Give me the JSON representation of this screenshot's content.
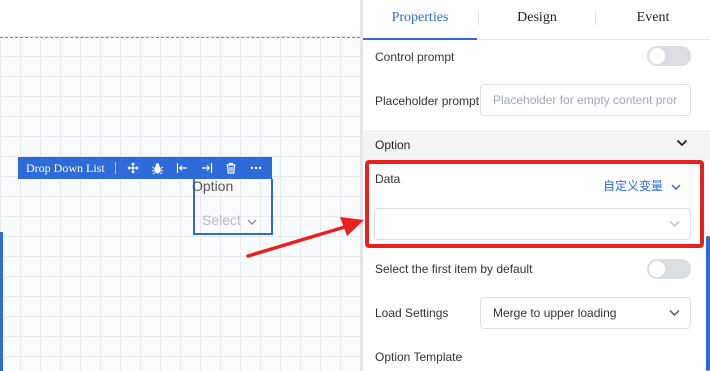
{
  "canvas": {
    "widget": {
      "title": "Drop Down List",
      "field_label": "Option",
      "select_placeholder": "Select",
      "toolbar_icons": [
        "move-icon",
        "bug-icon",
        "align-left-icon",
        "align-right-icon",
        "trash-icon",
        "more-icon"
      ]
    }
  },
  "panel": {
    "tabs": [
      {
        "label": "Properties",
        "active": true
      },
      {
        "label": "Design",
        "active": false
      },
      {
        "label": "Event",
        "active": false
      }
    ],
    "control_prompt": {
      "label": "Control prompt",
      "enabled": false
    },
    "placeholder_prompt": {
      "label": "Placeholder prompt",
      "placeholder": "Placeholder for empty content pror"
    },
    "option_section": {
      "title": "Option"
    },
    "data": {
      "label": "Data",
      "variable_link": "自定义变量",
      "value": ""
    },
    "select_first": {
      "label": "Select the first item by default",
      "enabled": false
    },
    "load_settings": {
      "label": "Load Settings",
      "value": "Merge to upper loading"
    },
    "option_template": {
      "label": "Option Template"
    }
  },
  "colors": {
    "accent": "#2f6bd8",
    "highlight": "#e8211f",
    "section_bg": "#f3f4f6"
  }
}
